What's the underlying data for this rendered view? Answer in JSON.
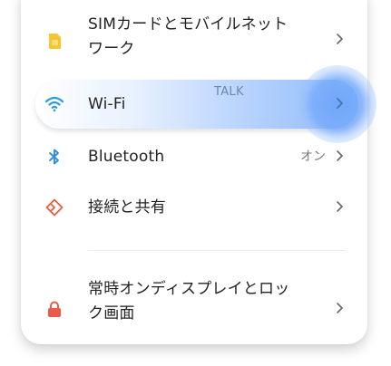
{
  "rows": {
    "sim": {
      "label_line1": "SIMカードとモバイルネット",
      "label_line2": "ワーク",
      "icon": "sim-card-icon"
    },
    "wifi": {
      "label": "Wi-Fi",
      "icon": "wifi-icon",
      "overlay_label": "TALK"
    },
    "bluetooth": {
      "label": "Bluetooth",
      "value": "オン",
      "icon": "bluetooth-icon"
    },
    "connection": {
      "label": "接続と共有",
      "icon": "connection-sharing-icon"
    },
    "aod": {
      "label_line1": "常時オンディスプレイとロッ",
      "label_line2": "ク画面",
      "icon": "lock-icon"
    }
  },
  "colors": {
    "sim_icon": "#f5c532",
    "wifi_icon": "#2d9be0",
    "bluetooth_icon": "#2d8fe0",
    "connection_icon": "#e5603f",
    "lock_icon": "#ea5b4a",
    "accent_glow": "#7aacf9"
  }
}
